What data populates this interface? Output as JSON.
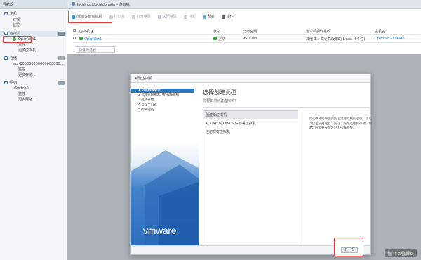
{
  "app": {
    "breadcrumb": "localhost.localdomain - 虚拟机"
  },
  "sidebar": {
    "header": "导航器",
    "items": [
      {
        "label": "主机",
        "level": 0
      },
      {
        "label": "管理",
        "level": 1
      },
      {
        "label": "监控",
        "level": 1
      },
      {
        "label": "虚拟机",
        "level": 0,
        "selected": true
      },
      {
        "label": "OpenWrt1",
        "level": 1
      },
      {
        "label": "监控",
        "level": 2
      },
      {
        "label": "更多虚拟机...",
        "level": 2
      },
      {
        "label": "存储",
        "level": 0
      },
      {
        "label": "esx-000000000000000000...",
        "level": 1
      },
      {
        "label": "监控",
        "level": 2
      },
      {
        "label": "更多存储...",
        "level": 2
      },
      {
        "label": "网络",
        "level": 0
      },
      {
        "label": "vSwitch0",
        "level": 1
      },
      {
        "label": "监控",
        "level": 2
      },
      {
        "label": "更多网络...",
        "level": 2
      }
    ]
  },
  "toolbar": {
    "buttons": [
      {
        "label": "创建/注册虚拟机",
        "enabled": true
      },
      {
        "label": "控制台",
        "enabled": false
      },
      {
        "label": "打开电源",
        "enabled": false
      },
      {
        "label": "关闭电源",
        "enabled": false
      },
      {
        "label": "挂起",
        "enabled": false
      },
      {
        "label": "刷新",
        "enabled": true
      },
      {
        "label": "操作",
        "enabled": true
      }
    ]
  },
  "vm_table": {
    "headers": [
      "虚拟机 ▲",
      "状态",
      "已用空间",
      "客户机操作系统",
      "主机名"
    ],
    "rows": [
      {
        "name": "OpenWrt1",
        "status": "正常",
        "used": "95.1 MB",
        "os": "其他 3.x 或更高版本的 Linux (64 位)",
        "host": "OpenWrt-00e045"
      }
    ],
    "quick_filter": "快速筛选器"
  },
  "dialog": {
    "title": "新建虚拟机",
    "steps": [
      "1 选择创建类型",
      "2 选择名称和客户机操作系统",
      "3 选择存储",
      "4 自定义设置",
      "5 即将完成"
    ],
    "heading": "选择创建类型",
    "subheading": "您要如何创建虚拟机?",
    "options": [
      "创建新虚拟机",
      "从 OVF 或 OVA 文件部署虚拟机",
      "注册现有虚拟机"
    ],
    "description": "此选项将指导您完成创建虚拟机的过程。您可以自定义处理器、内存、网络连接和存储。创建之后需要安装客户机操作系统。",
    "logo": "vmware",
    "next_button": "下一页"
  },
  "watermark": "值 什么值得买",
  "colors": {
    "highlight": "#e23b3b",
    "accent": "#2c75bf",
    "link": "#1a7bc1",
    "ok": "#3da342"
  }
}
